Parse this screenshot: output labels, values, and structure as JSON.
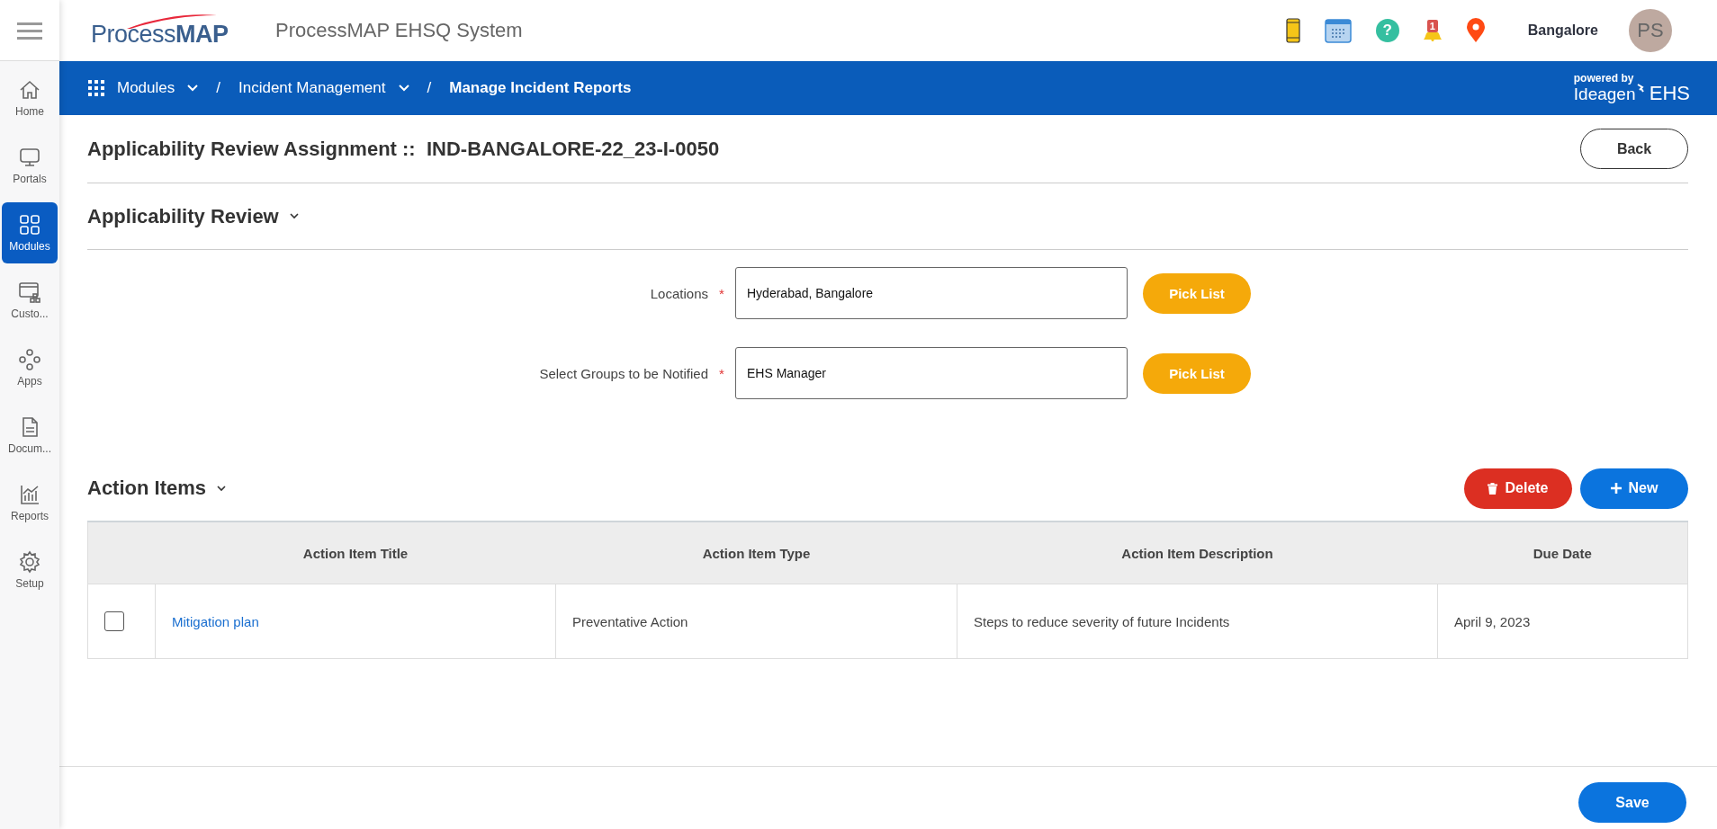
{
  "header": {
    "logo": "Process**MAP**",
    "app_title": "ProcessMAP EHSQ System",
    "help_symbol": "?",
    "notification_count": "1",
    "location": "Bangalore",
    "avatar_initials": "PS"
  },
  "sidebar": {
    "items": [
      {
        "label": "Home",
        "selected": false
      },
      {
        "label": "Portals",
        "selected": false
      },
      {
        "label": "Modules",
        "selected": true
      },
      {
        "label": "Custo...",
        "selected": false
      },
      {
        "label": "Apps",
        "selected": false
      },
      {
        "label": "Docum...",
        "selected": false
      },
      {
        "label": "Reports",
        "selected": false
      },
      {
        "label": "Setup",
        "selected": false
      }
    ]
  },
  "breadcrumb": {
    "separator": "/",
    "items": [
      {
        "label": "Modules",
        "dropdown": true,
        "current": false
      },
      {
        "label": "Incident Management",
        "dropdown": true,
        "current": false
      },
      {
        "label": "Manage Incident Reports",
        "dropdown": false,
        "current": true
      }
    ]
  },
  "powered_by": {
    "caption": "powered by",
    "brand": "Ideagen",
    "product": "EHS"
  },
  "page": {
    "title": "Applicability Review Assignment ::  IND-BANGALORE-22_23-I-0050",
    "back_button": "Back"
  },
  "applicability_review": {
    "heading": "Applicability Review",
    "fields": [
      {
        "label": "Locations",
        "required_mark": "*",
        "value": "Hyderabad, Bangalore",
        "button": "Pick List"
      },
      {
        "label": "Select Groups to be Notified",
        "required_mark": "*",
        "value": "EHS Manager",
        "button": "Pick List"
      }
    ]
  },
  "action_items": {
    "heading": "Action Items",
    "delete_button": "Delete",
    "new_button": "New",
    "table": {
      "columns": [
        "Action Item Title",
        "Action Item Type",
        "Action Item Description",
        "Due Date"
      ],
      "rows": [
        {
          "checked": false,
          "title": "Mitigation plan",
          "type": "Preventative Action",
          "description": "Steps to reduce severity of future Incidents",
          "due_date": "April 9, 2023"
        }
      ]
    }
  },
  "footer": {
    "save_button": "Save"
  }
}
